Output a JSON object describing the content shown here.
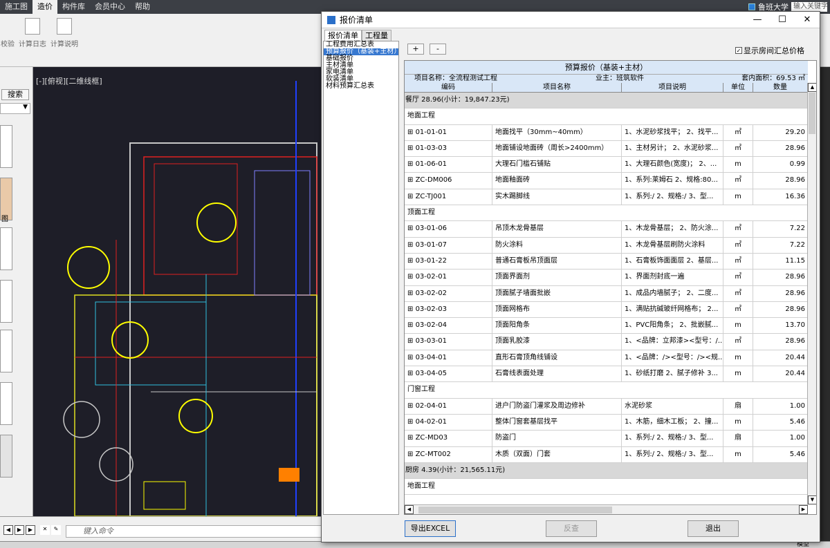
{
  "menubar": {
    "items": [
      "施工图",
      "造价",
      "构件库",
      "会员中心",
      "帮助"
    ],
    "active": "造价",
    "university": "鲁班大学",
    "search_placeholder": "输入关键字"
  },
  "ribbon": {
    "buttons": [
      "校验",
      "计算日志",
      "计算说明"
    ]
  },
  "left_panel": {
    "search_label": "搜索",
    "tile_label": "图"
  },
  "cad": {
    "view_label": "[-][俯视][二维线框]",
    "command_placeholder": "键入命令"
  },
  "status": {
    "model_label": "模型"
  },
  "dialog": {
    "title": "报价清单",
    "tabs": [
      "报价清单",
      "工程量"
    ],
    "active_tab": "报价清单",
    "tree_items": [
      "工程费用汇总表",
      "预算报价（基装+主材）",
      "基础报价",
      "主材清单",
      "家电清单",
      "软装清单",
      "材料预算汇总表"
    ],
    "selected_tree_item": "预算报价（基装+主材）",
    "plus_label": "+",
    "minus_label": "-",
    "show_room_total_label": "显示房间汇总价格",
    "show_room_total_checked": true,
    "sheet_title": "预算报价（基装+主材）",
    "project_name": "项目名称：全流程测试工程",
    "owner": "业主：班筑软件",
    "area": "套内面积：69.53 ㎡",
    "columns": [
      "编码",
      "项目名称",
      "项目说明",
      "单位",
      "数量"
    ],
    "rows": [
      {
        "type": "group",
        "text": "餐厅 28.96(小计：19,847.23元)"
      },
      {
        "type": "section",
        "text": "地面工程"
      },
      {
        "type": "item",
        "code": "01-01-01",
        "name": "地面找平（30mm~40mm）",
        "desc": "1、水泥砂浆找平； 2、找平...",
        "unit": "㎡",
        "qty": "29.20"
      },
      {
        "type": "item",
        "code": "01-03-03",
        "name": "地面铺设地面砖（周长>2400mm）",
        "desc": "1、主材另计； 2、水泥砂浆...",
        "unit": "㎡",
        "qty": "28.96"
      },
      {
        "type": "item",
        "code": "01-06-01",
        "name": "大理石门槛石铺贴",
        "desc": "1、大理石颜色(宽度)； 2、...",
        "unit": "m",
        "qty": "0.99"
      },
      {
        "type": "item",
        "code": "ZC-DM006",
        "name": "地面釉面砖",
        "desc": "1、系列:莱姆石 2、规格:80...",
        "unit": "㎡",
        "qty": "28.96"
      },
      {
        "type": "item",
        "code": "ZC-TJ001",
        "name": "实木踢脚线",
        "desc": "1、系列:/ 2、规格:/ 3、型...",
        "unit": "m",
        "qty": "16.36"
      },
      {
        "type": "section",
        "text": "顶面工程"
      },
      {
        "type": "item",
        "code": "03-01-06",
        "name": "吊顶木龙骨基层",
        "desc": "1、木龙骨基层； 2、防火涂...",
        "unit": "㎡",
        "qty": "7.22"
      },
      {
        "type": "item",
        "code": "03-01-07",
        "name": "防火涂料",
        "desc": "1、木龙骨基层刷防火涂料",
        "unit": "㎡",
        "qty": "7.22"
      },
      {
        "type": "item",
        "code": "03-01-22",
        "name": "普通石膏板吊顶面层",
        "desc": "1、石膏板饰面面层 2、基层...",
        "unit": "㎡",
        "qty": "11.15"
      },
      {
        "type": "item",
        "code": "03-02-01",
        "name": "顶面界面剂",
        "desc": "1、界面剂封底一遍",
        "unit": "㎡",
        "qty": "28.96"
      },
      {
        "type": "item",
        "code": "03-02-02",
        "name": "顶面腻子墙面批嵌",
        "desc": "1、成品内墙腻子； 2、二度...",
        "unit": "㎡",
        "qty": "28.96"
      },
      {
        "type": "item",
        "code": "03-02-03",
        "name": "顶面网格布",
        "desc": "1、满贴抗碱玻纤网格布； 2...",
        "unit": "㎡",
        "qty": "28.96"
      },
      {
        "type": "item",
        "code": "03-02-04",
        "name": "顶面阳角条",
        "desc": "1、PVC阳角条； 2、批嵌腻...",
        "unit": "m",
        "qty": "13.70"
      },
      {
        "type": "item",
        "code": "03-03-01",
        "name": "顶面乳胶漆",
        "desc": "1、<品牌：立邦漆><型号：/...",
        "unit": "㎡",
        "qty": "28.96"
      },
      {
        "type": "item",
        "code": "03-04-01",
        "name": "直形石膏顶角线铺设",
        "desc": "1、<品牌：/><型号：/><规...",
        "unit": "m",
        "qty": "20.44"
      },
      {
        "type": "item",
        "code": "03-04-05",
        "name": "石膏线表面处理",
        "desc": "1、砂纸打磨 2、腻子修补 3...",
        "unit": "m",
        "qty": "20.44"
      },
      {
        "type": "section",
        "text": "门窗工程"
      },
      {
        "type": "item",
        "code": "02-04-01",
        "name": "进户门防盗门灌浆及周边修补",
        "desc": "水泥砂浆",
        "unit": "扇",
        "qty": "1.00"
      },
      {
        "type": "item",
        "code": "04-02-01",
        "name": "整体门窗套基层找平",
        "desc": "1、木筋，细木工板； 2、撞...",
        "unit": "m",
        "qty": "5.46"
      },
      {
        "type": "item",
        "code": "ZC-MD03",
        "name": "防盗门",
        "desc": "1、系列:/ 2、规格:/ 3、型...",
        "unit": "扇",
        "qty": "1.00"
      },
      {
        "type": "item",
        "code": "ZC-MT002",
        "name": "木质（双面）门套",
        "desc": "1、系列:/ 2、规格:/ 3、型...",
        "unit": "m",
        "qty": "5.46"
      },
      {
        "type": "group",
        "text": "厨房 4.39(小计：21,565.11元)"
      },
      {
        "type": "section",
        "text": "地面工程"
      }
    ],
    "buttons": {
      "export": "导出EXCEL",
      "review": "反查",
      "exit": "退出"
    }
  }
}
